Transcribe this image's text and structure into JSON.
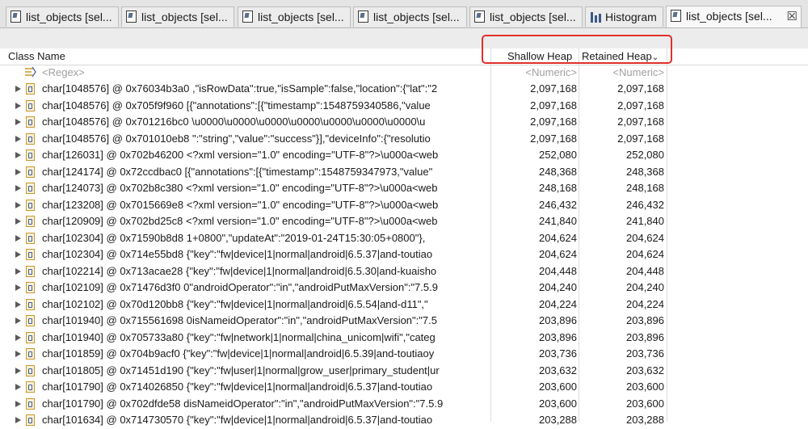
{
  "tabs": [
    {
      "label": "list_objects [sel...",
      "icon": "object-list-icon",
      "active": false
    },
    {
      "label": "list_objects [sel...",
      "icon": "object-list-icon",
      "active": false
    },
    {
      "label": "list_objects [sel...",
      "icon": "object-list-icon",
      "active": false
    },
    {
      "label": "list_objects [sel...",
      "icon": "object-list-icon",
      "active": false
    },
    {
      "label": "list_objects [sel...",
      "icon": "object-list-icon",
      "active": false
    },
    {
      "label": "Histogram",
      "icon": "histogram-icon",
      "active": false
    },
    {
      "label": "list_objects [sel...",
      "icon": "object-list-icon",
      "active": true,
      "close": "☒"
    }
  ],
  "columns": {
    "class_name": "Class Name",
    "shallow_heap": "Shallow Heap",
    "retained_heap": "Retained Heap"
  },
  "filter": {
    "regex": "<Regex>",
    "shallow": "<Numeric>",
    "retained": "<Numeric>"
  },
  "highlight_color": "#e0302a",
  "rows": [
    {
      "name": "char[1048576] @ 0x76034b3a0  ,\"isRowData\":true,\"isSample\":false,\"location\":{\"lat\":\"2",
      "shallow": "2,097,168",
      "retained": "2,097,168"
    },
    {
      "name": "char[1048576] @ 0x705f9f960  [{\"annotations\":[{\"timestamp\":1548759340586,\"value",
      "shallow": "2,097,168",
      "retained": "2,097,168"
    },
    {
      "name": "char[1048576] @ 0x701216bc0  \\u0000\\u0000\\u0000\\u0000\\u0000\\u0000\\u0000\\u",
      "shallow": "2,097,168",
      "retained": "2,097,168"
    },
    {
      "name": "char[1048576] @ 0x701010eb8  \":\"string\",\"value\":\"success\"}],\"deviceInfo\":{\"resolutio",
      "shallow": "2,097,168",
      "retained": "2,097,168"
    },
    {
      "name": "char[126031] @ 0x702b46200  <?xml version=\"1.0\" encoding=\"UTF-8\"?>\\u000a<web",
      "shallow": "252,080",
      "retained": "252,080"
    },
    {
      "name": "char[124174] @ 0x72ccdbac0  [{\"annotations\":[{\"timestamp\":1548759347973,\"value\"",
      "shallow": "248,368",
      "retained": "248,368"
    },
    {
      "name": "char[124073] @ 0x702b8c380  <?xml version=\"1.0\" encoding=\"UTF-8\"?>\\u000a<web",
      "shallow": "248,168",
      "retained": "248,168"
    },
    {
      "name": "char[123208] @ 0x7015669e8  <?xml version=\"1.0\" encoding=\"UTF-8\"?>\\u000a<web",
      "shallow": "246,432",
      "retained": "246,432"
    },
    {
      "name": "char[120909] @ 0x702bd25c8  <?xml version=\"1.0\" encoding=\"UTF-8\"?>\\u000a<web",
      "shallow": "241,840",
      "retained": "241,840"
    },
    {
      "name": "char[102304] @ 0x71590b8d8  1+0800\",\"updateAt\":\"2019-01-24T15:30:05+0800\"},",
      "shallow": "204,624",
      "retained": "204,624"
    },
    {
      "name": "char[102304] @ 0x714e55bd8  {\"key\":\"fw|device|1|normal|android|6.5.37|and-toutiao",
      "shallow": "204,624",
      "retained": "204,624"
    },
    {
      "name": "char[102214] @ 0x713acae28  {\"key\":\"fw|device|1|normal|android|6.5.30|and-kuaisho",
      "shallow": "204,448",
      "retained": "204,448"
    },
    {
      "name": "char[102109] @ 0x71476d3f0  0\"androidOperator\":\"in\",\"androidPutMaxVersion\":\"7.5.9",
      "shallow": "204,240",
      "retained": "204,240"
    },
    {
      "name": "char[102102] @ 0x70d120bb8  {\"key\":\"fw|device|1|normal|android|6.5.54|and-d11\",\"",
      "shallow": "204,224",
      "retained": "204,224"
    },
    {
      "name": "char[101940] @ 0x715561698  0isNameidOperator\":\"in\",\"androidPutMaxVersion\":\"7.5",
      "shallow": "203,896",
      "retained": "203,896"
    },
    {
      "name": "char[101940] @ 0x705733a80  {\"key\":\"fw|network|1|normal|china_unicom|wifi\",\"categ",
      "shallow": "203,896",
      "retained": "203,896"
    },
    {
      "name": "char[101859] @ 0x704b9acf0  {\"key\":\"fw|device|1|normal|android|6.5.39|and-toutiaoy",
      "shallow": "203,736",
      "retained": "203,736"
    },
    {
      "name": "char[101805] @ 0x71451d190  {\"key\":\"fw|user|1|normal|grow_user|primary_student|ur",
      "shallow": "203,632",
      "retained": "203,632"
    },
    {
      "name": "char[101790] @ 0x714026850  {\"key\":\"fw|device|1|normal|android|6.5.37|and-toutiao",
      "shallow": "203,600",
      "retained": "203,600"
    },
    {
      "name": "char[101790] @ 0x702dfde58  disNameidOperator\":\"in\",\"androidPutMaxVersion\":\"7.5.9",
      "shallow": "203,600",
      "retained": "203,600"
    },
    {
      "name": "char[101634] @ 0x714730570  {\"key\":\"fw|device|1|normal|android|6.5.37|and-toutiao",
      "shallow": "203,288",
      "retained": "203,288"
    }
  ]
}
